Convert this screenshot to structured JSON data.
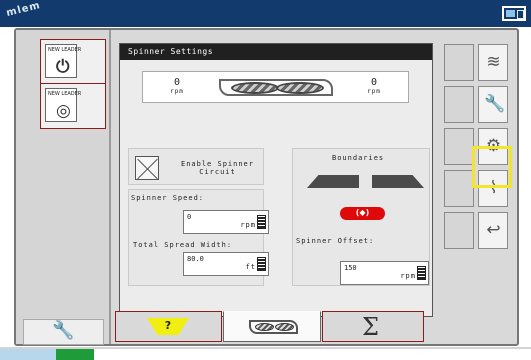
{
  "top_bar": {
    "brand": "NEW LEADER",
    "brand_mark": "mlem",
    "display_icon": "display-window-icon"
  },
  "left_tabs": [
    {
      "label": "NEW LEADER",
      "icon": "control-knob-icon"
    },
    {
      "label": "NEW LEADER",
      "icon": "spinner-module-icon"
    }
  ],
  "panel": {
    "title": "Spinner Settings",
    "left_rpm_value": "0",
    "left_rpm_unit": "rpm",
    "right_rpm_value": "0",
    "right_rpm_unit": "rpm",
    "enable_spinner_circuit": "Enable Spinner Circuit",
    "spinner_speed_label": "Spinner Speed:",
    "spinner_speed_value": "0",
    "spinner_speed_unit": "rpm",
    "total_spread_width_label": "Total Spread Width:",
    "total_spread_width_value": "80.0",
    "total_spread_width_unit": "ft",
    "boundaries_label": "Boundaries",
    "spinner_offset_label": "Spinner Offset:",
    "spinner_offset_value": "150",
    "spinner_offset_unit": "rpm",
    "offset_button": "(◆)"
  },
  "bottom_tabs": {
    "help": "?",
    "spinner": "spinner-tab-icon",
    "summary": "Σ"
  },
  "right_menu": [
    {
      "icon": "spread-pattern-icon"
    },
    {
      "icon": "wrench-icon"
    },
    {
      "icon": "gear-icon"
    },
    {
      "icon": "diagnostic-icon"
    },
    {
      "icon": "back-arrow-icon"
    }
  ],
  "colors": {
    "top_bar": "#123a6d",
    "accent_red": "#df0909",
    "help_yellow": "#f1ef12",
    "highlight_yellow": "#f3e52a",
    "status_green": "#1f9b39"
  }
}
